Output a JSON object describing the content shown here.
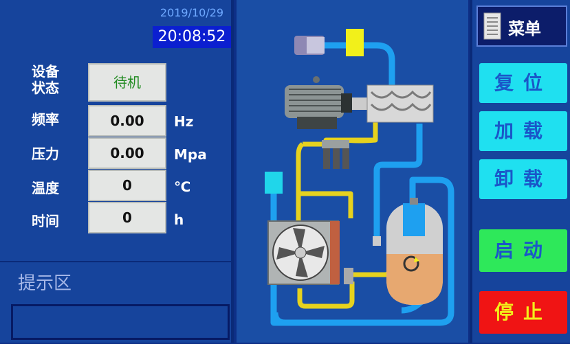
{
  "header": {
    "date": "2019/10/29",
    "time": "20:08:52"
  },
  "status": {
    "rows": [
      {
        "label": "设备\n状态",
        "value": "待机",
        "unit": ""
      },
      {
        "label": "频率",
        "value": "0.00",
        "unit": "Hz"
      },
      {
        "label": "压力",
        "value": "0.00",
        "unit": "Mpa"
      },
      {
        "label": "温度",
        "value": "0",
        "unit": "℃"
      },
      {
        "label": "时间",
        "value": "0",
        "unit": "h"
      }
    ],
    "status_value_color": "#1f8a1f"
  },
  "hint": {
    "title": "提示区",
    "message": ""
  },
  "menu": {
    "label": "菜单",
    "icon": "document-icon"
  },
  "buttons": {
    "reset": {
      "label": "复位",
      "color": "#1fe0f0"
    },
    "load": {
      "label": "加载",
      "color": "#1fe0f0"
    },
    "unload": {
      "label": "卸载",
      "color": "#1fe0f0"
    },
    "start": {
      "label": "启动",
      "color": "#2ee85a"
    },
    "stop": {
      "label": "停止",
      "color": "#f01414"
    }
  },
  "diagram": {
    "pipe_blue": "#1ea0f0",
    "pipe_yellow": "#e6d21e"
  }
}
